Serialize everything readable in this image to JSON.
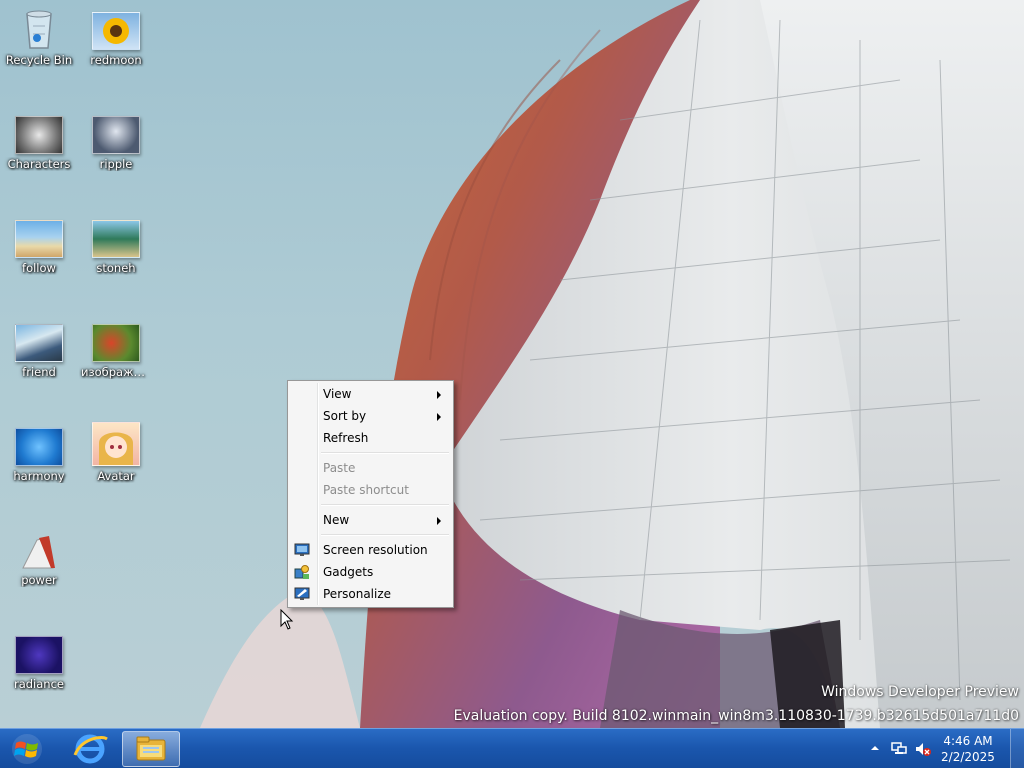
{
  "desktop": {
    "icons": [
      {
        "label": "Recycle Bin",
        "icon": "recycle-bin-icon"
      },
      {
        "label": "redmoon",
        "icon": "sunflower-image-icon"
      },
      {
        "label": "Characters",
        "icon": "characters-image-icon"
      },
      {
        "label": "ripple",
        "icon": "ripple-image-icon"
      },
      {
        "label": "follow",
        "icon": "beach-image-icon"
      },
      {
        "label": "stoneh",
        "icon": "coast-image-icon"
      },
      {
        "label": "friend",
        "icon": "railway-image-icon"
      },
      {
        "label": "изображен...",
        "icon": "flowers-image-icon"
      },
      {
        "label": "harmony",
        "icon": "blue-image-icon"
      },
      {
        "label": "Avatar",
        "icon": "anime-avatar-image-icon"
      },
      {
        "label": "power",
        "icon": "power-image-icon"
      },
      {
        "label": "radiance",
        "icon": "radiance-image-icon"
      }
    ],
    "watermark": {
      "line1": "Windows Developer Preview",
      "line2": "Evaluation copy. Build 8102.winmain_win8m3.110830-1739.b32615d501a711d0"
    }
  },
  "context_menu": {
    "items": [
      {
        "label": "View",
        "submenu": true
      },
      {
        "label": "Sort by",
        "submenu": true
      },
      {
        "label": "Refresh"
      },
      {
        "label": "Paste",
        "disabled": true
      },
      {
        "label": "Paste shortcut",
        "disabled": true
      },
      {
        "label": "New",
        "submenu": true
      },
      {
        "label": "Screen resolution",
        "icon": "screen-resolution-icon"
      },
      {
        "label": "Gadgets",
        "icon": "gadgets-icon"
      },
      {
        "label": "Personalize",
        "icon": "personalize-icon"
      }
    ]
  },
  "taskbar": {
    "start_icon": "windows-logo-icon",
    "pinned": [
      {
        "icon": "internet-explorer-icon"
      },
      {
        "icon": "file-explorer-icon",
        "active": true
      }
    ],
    "tray": {
      "time": "4:46 AM",
      "date": "2/2/2025"
    }
  },
  "colors": {
    "taskbar": "#1a56ad",
    "menu_bg": "#f5f5f5",
    "menu_border": "#979797",
    "disabled_text": "#8d8d8d"
  }
}
